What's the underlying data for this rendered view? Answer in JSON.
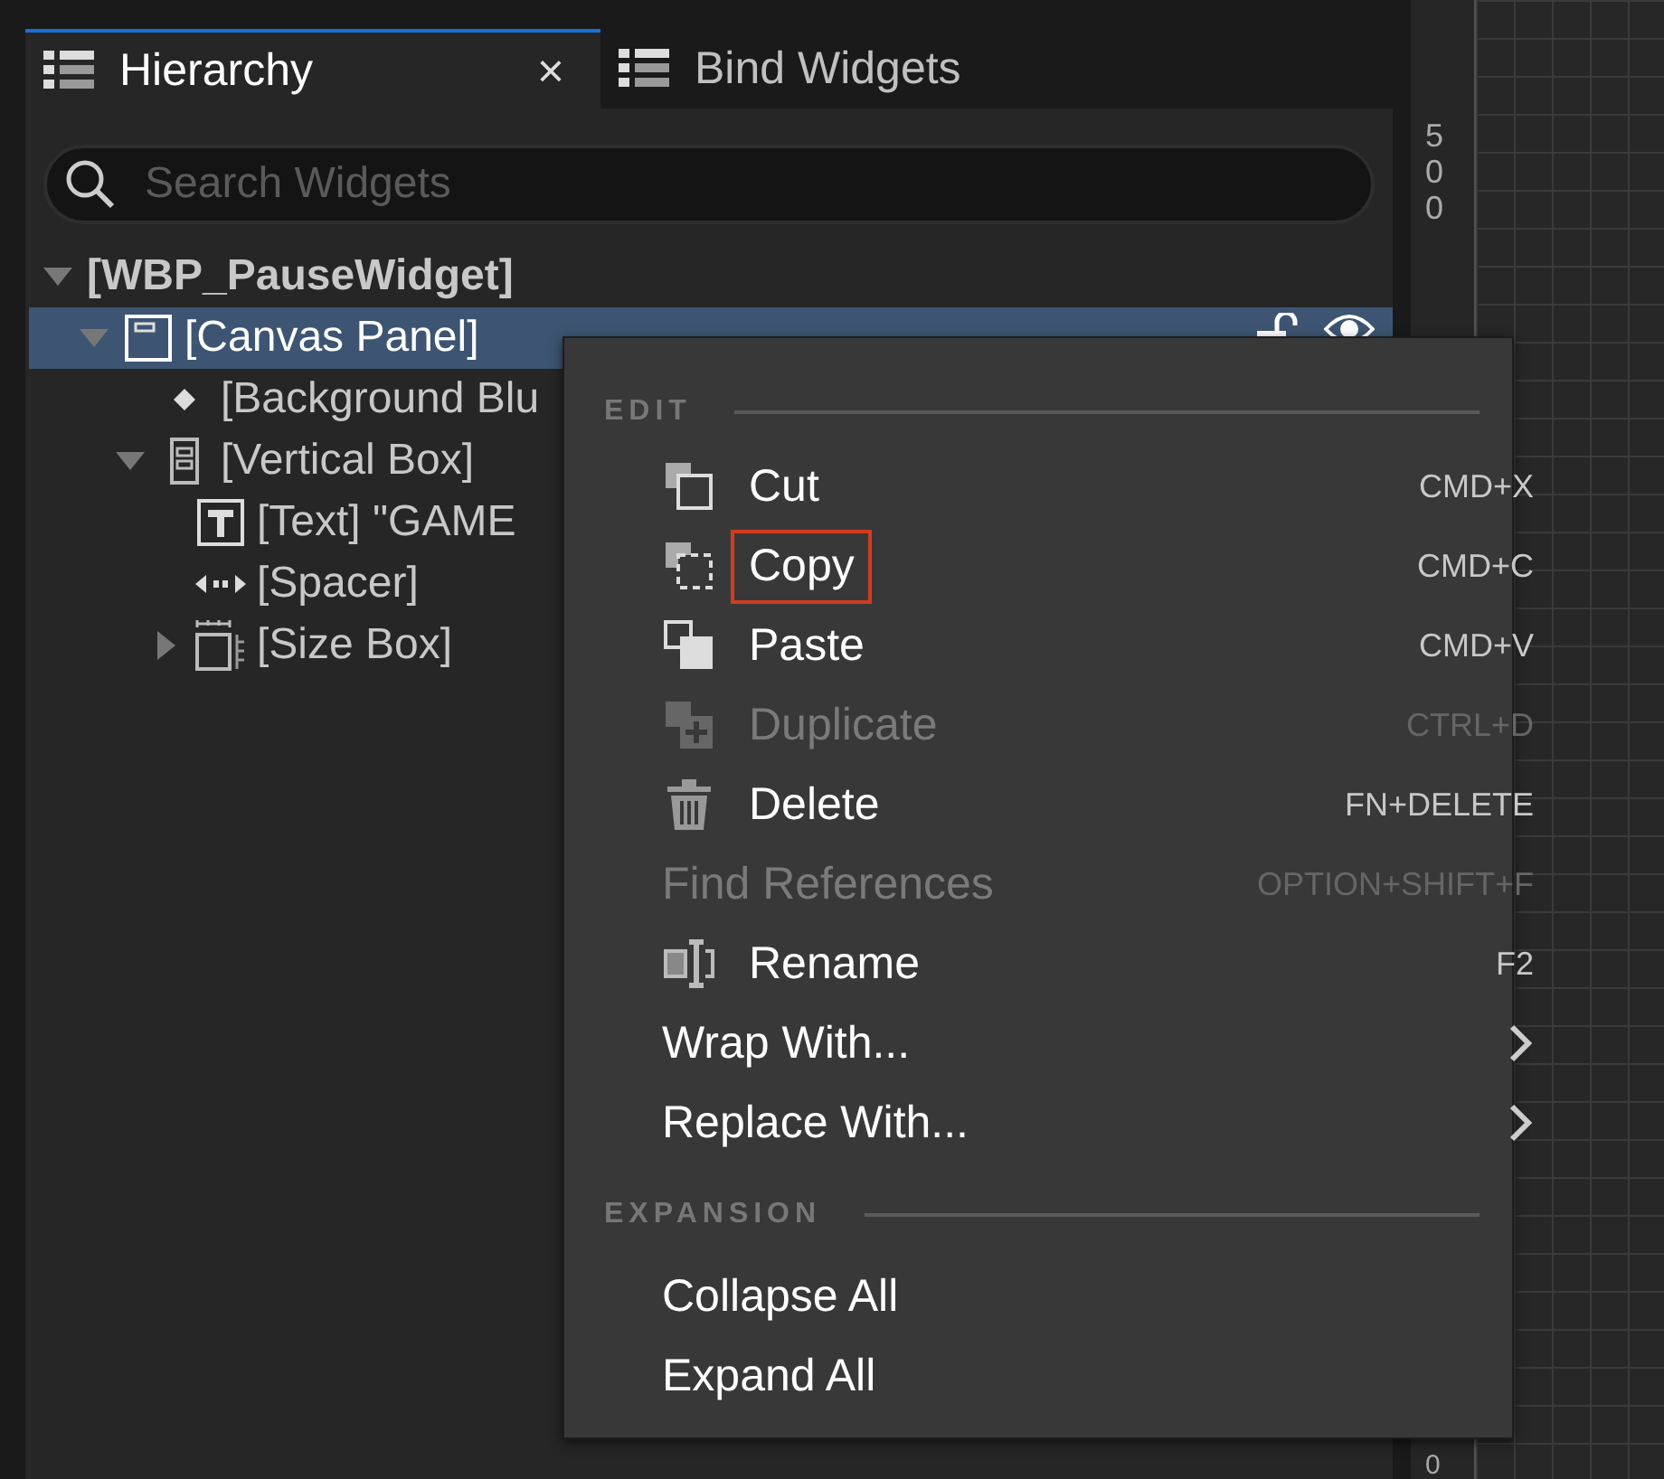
{
  "tabs": [
    {
      "label": "Hierarchy",
      "selected": true,
      "close": "×"
    },
    {
      "label": "Bind Widgets",
      "selected": false
    }
  ],
  "search": {
    "placeholder": "Search Widgets"
  },
  "tree": [
    {
      "label": "[WBP_PauseWidget]",
      "kind": "root",
      "expanded": true,
      "selected": false,
      "children": [
        {
          "label": "[Canvas Panel]",
          "kind": "canvas",
          "expanded": true,
          "selected": true,
          "children": [
            {
              "label": "[Background Blu",
              "kind": "blur",
              "selected": false
            },
            {
              "label": "[Vertical Box]",
              "kind": "vbox",
              "expanded": true,
              "selected": false,
              "children": [
                {
                  "label": "[Text] \"GAME",
                  "kind": "text",
                  "selected": false
                },
                {
                  "label": "[Spacer]",
                  "kind": "spacer",
                  "selected": false
                },
                {
                  "label": "[Size Box]",
                  "kind": "sizebox",
                  "expanded": false,
                  "selected": false
                }
              ]
            }
          ]
        }
      ]
    }
  ],
  "ruler": {
    "labels": [
      "500",
      "0"
    ]
  },
  "context_menu": {
    "sections": [
      {
        "title": "EDIT",
        "items": [
          {
            "label": "Cut",
            "kind": "cut",
            "shortcut": "CMD+X",
            "disabled": false
          },
          {
            "label": "Copy",
            "kind": "copy",
            "shortcut": "CMD+C",
            "disabled": false,
            "annotated": true
          },
          {
            "label": "Paste",
            "kind": "paste",
            "shortcut": "CMD+V",
            "disabled": false
          },
          {
            "label": "Duplicate",
            "kind": "duplicate",
            "shortcut": "CTRL+D",
            "disabled": true
          },
          {
            "label": "Delete",
            "kind": "delete",
            "shortcut": "FN+DELETE",
            "disabled": false
          },
          {
            "label": "Find References",
            "shortcut": "OPTION+SHIFT+F",
            "disabled": true
          },
          {
            "label": "Rename",
            "kind": "rename",
            "shortcut": "F2",
            "disabled": false
          },
          {
            "label": "Wrap With...",
            "submenu": true,
            "disabled": false
          },
          {
            "label": "Replace With...",
            "submenu": true,
            "disabled": false
          }
        ]
      },
      {
        "title": "EXPANSION",
        "items": [
          {
            "label": "Collapse All",
            "disabled": false
          },
          {
            "label": "Expand All",
            "disabled": false
          }
        ]
      }
    ]
  }
}
